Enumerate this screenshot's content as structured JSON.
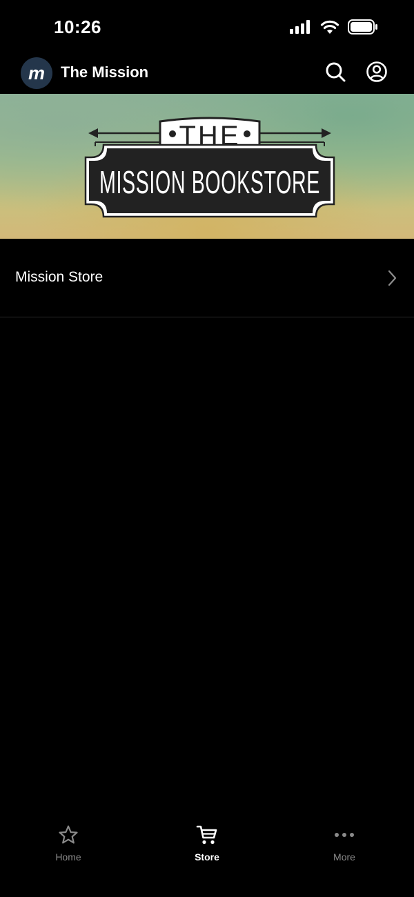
{
  "status_bar": {
    "time": "10:26",
    "icons": [
      "cellular-signal-icon",
      "wifi-icon",
      "battery-icon"
    ]
  },
  "header": {
    "avatar_letter": "m",
    "title": "The Mission",
    "actions": [
      "search-icon",
      "account-icon"
    ]
  },
  "banner": {
    "line1": "THE",
    "line2": "MISSION BOOKSTORE"
  },
  "store_list": {
    "items": [
      {
        "label": "Mission Store"
      }
    ]
  },
  "tab_bar": {
    "tabs": [
      {
        "label": "Home",
        "icon": "star-icon"
      },
      {
        "label": "Store",
        "icon": "cart-icon",
        "selected": true
      },
      {
        "label": "More",
        "icon": "more-dots-icon"
      }
    ]
  },
  "colors": {
    "background": "#000000",
    "text": "#ffffff",
    "inactive_tab": "#8a8a8a",
    "avatar_bg": "#24364b",
    "divider": "#2a2a2a"
  }
}
